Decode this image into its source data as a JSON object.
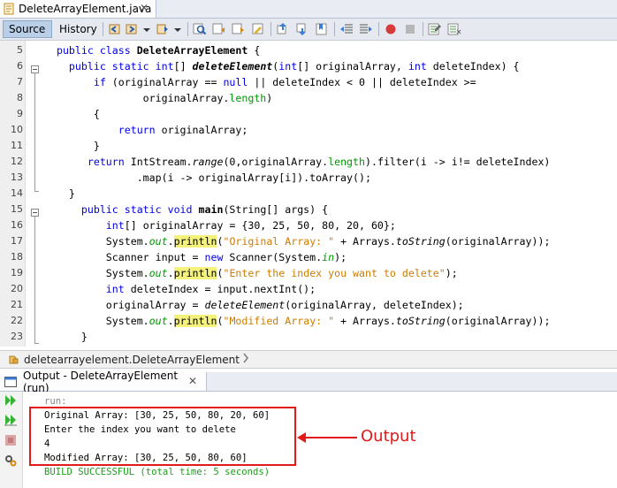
{
  "editor_tab": {
    "label": "DeleteArrayElement.java",
    "close": "✕"
  },
  "toolbar": {
    "source_label": "Source",
    "history_label": "History"
  },
  "code_lines": [
    {
      "num": "5",
      "parts": [
        [
          "  public class ",
          "kw"
        ],
        [
          "DeleteArrayElement",
          "b"
        ],
        [
          " {",
          ""
        ]
      ]
    },
    {
      "num": "6",
      "parts": [
        [
          "    public static int",
          "kw"
        ],
        [
          "[] ",
          ""
        ],
        [
          "deleteElement",
          "bi"
        ],
        [
          "(",
          ""
        ],
        [
          "int",
          "kw"
        ],
        [
          "[] originalArray, ",
          ""
        ],
        [
          "int",
          "kw"
        ],
        [
          " deleteIndex) {",
          ""
        ]
      ]
    },
    {
      "num": "7",
      "parts": [
        [
          "        if",
          "kw"
        ],
        [
          " (originalArray == ",
          ""
        ],
        [
          "null",
          "kw"
        ],
        [
          " || deleteIndex < 0 || deleteIndex >=",
          ""
        ]
      ]
    },
    {
      "num": "8",
      "parts": [
        [
          "                originalArray.",
          ""
        ],
        [
          "length",
          "fld"
        ],
        [
          ")",
          ""
        ]
      ]
    },
    {
      "num": "9",
      "parts": [
        [
          "        {",
          ""
        ]
      ]
    },
    {
      "num": "10",
      "parts": [
        [
          "            return",
          "kw"
        ],
        [
          " originalArray;",
          ""
        ]
      ]
    },
    {
      "num": "11",
      "parts": [
        [
          "        }",
          ""
        ]
      ]
    },
    {
      "num": "12",
      "parts": [
        [
          "       return",
          "kw"
        ],
        [
          " IntStream.",
          ""
        ],
        [
          "range",
          "it"
        ],
        [
          "(0,originalArray.",
          ""
        ],
        [
          "length",
          "fld"
        ],
        [
          ").filter(i -> i!= deleteIndex)",
          ""
        ]
      ]
    },
    {
      "num": "13",
      "parts": [
        [
          "               .map(i -> originalArray[i]).toArray();",
          ""
        ]
      ]
    },
    {
      "num": "14",
      "parts": [
        [
          "    }",
          ""
        ]
      ]
    },
    {
      "num": "15",
      "parts": [
        [
          "      public static void",
          "kw"
        ],
        [
          " ",
          ""
        ],
        [
          "main",
          "b"
        ],
        [
          "(String[] args) {",
          ""
        ]
      ]
    },
    {
      "num": "16",
      "parts": [
        [
          "          int",
          "kw"
        ],
        [
          "[] originalArray = {30, 25, 50, 80, 20, 60};",
          ""
        ]
      ]
    },
    {
      "num": "17",
      "parts": [
        [
          "          System.",
          ""
        ],
        [
          "out",
          "fld it"
        ],
        [
          ".",
          ""
        ],
        [
          "println",
          "hl"
        ],
        [
          "(",
          ""
        ],
        [
          "\"Original Array: \"",
          "str"
        ],
        [
          " + Arrays.",
          ""
        ],
        [
          "toString",
          "it"
        ],
        [
          "(originalArray));",
          ""
        ]
      ]
    },
    {
      "num": "18",
      "parts": [
        [
          "          Scanner input = ",
          ""
        ],
        [
          "new",
          "kw"
        ],
        [
          " Scanner(System.",
          ""
        ],
        [
          "in",
          "fld it"
        ],
        [
          ");",
          ""
        ]
      ]
    },
    {
      "num": "19",
      "parts": [
        [
          "          System.",
          ""
        ],
        [
          "out",
          "fld it"
        ],
        [
          ".",
          ""
        ],
        [
          "println",
          "hl"
        ],
        [
          "(",
          ""
        ],
        [
          "\"Enter the index you want to delete\"",
          "str"
        ],
        [
          ");",
          ""
        ]
      ]
    },
    {
      "num": "20",
      "parts": [
        [
          "          int",
          "kw"
        ],
        [
          " deleteIndex = input.nextInt();",
          ""
        ]
      ]
    },
    {
      "num": "21",
      "parts": [
        [
          "          originalArray = ",
          ""
        ],
        [
          "deleteElement",
          "it"
        ],
        [
          "(originalArray, deleteIndex);",
          ""
        ]
      ]
    },
    {
      "num": "22",
      "parts": [
        [
          "          System.",
          ""
        ],
        [
          "out",
          "fld it"
        ],
        [
          ".",
          ""
        ],
        [
          "println",
          "hl"
        ],
        [
          "(",
          ""
        ],
        [
          "\"Modified Array: \"",
          "str"
        ],
        [
          " + Arrays.",
          ""
        ],
        [
          "toString",
          "it"
        ],
        [
          "(originalArray));",
          ""
        ]
      ]
    },
    {
      "num": "23",
      "parts": [
        [
          "      }",
          ""
        ]
      ]
    }
  ],
  "breadcrumb": {
    "label": "deletearrayelement.DeleteArrayElement"
  },
  "output": {
    "tab_label": "Output - DeleteArrayElement (run)",
    "close": "✕",
    "lines": [
      {
        "text": "run:",
        "style": "con-gray"
      },
      {
        "text": "Original Array: [30, 25, 50, 80, 20, 60]",
        "style": ""
      },
      {
        "text": "Enter the index you want to delete",
        "style": ""
      },
      {
        "text": "4",
        "style": ""
      },
      {
        "text": "Modified Array: [30, 25, 50, 80, 60]",
        "style": ""
      },
      {
        "text": "BUILD SUCCESSFUL (total time: 5 seconds)",
        "style": "con-green"
      }
    ]
  },
  "annotation": {
    "label": "Output"
  },
  "colors": {
    "keyword": "#0000e6",
    "string": "#ce7b00",
    "field": "#009900",
    "highlight": "#f4f27b",
    "annotation": "#e21a1a"
  },
  "icons": [
    "java-file-icon",
    "back-icon",
    "forward-icon",
    "search-icon",
    "prev-occurrence-icon",
    "next-occurrence-icon",
    "toggle-highlight-icon",
    "prev-bookmark-icon",
    "next-bookmark-icon",
    "toggle-bookmark-icon",
    "shift-left-icon",
    "shift-right-icon",
    "start-macro-icon",
    "stop-macro-icon",
    "comment-icon",
    "uncomment-icon",
    "rerun-icon",
    "rerun-with-args-icon",
    "stop-icon",
    "settings-icon"
  ]
}
